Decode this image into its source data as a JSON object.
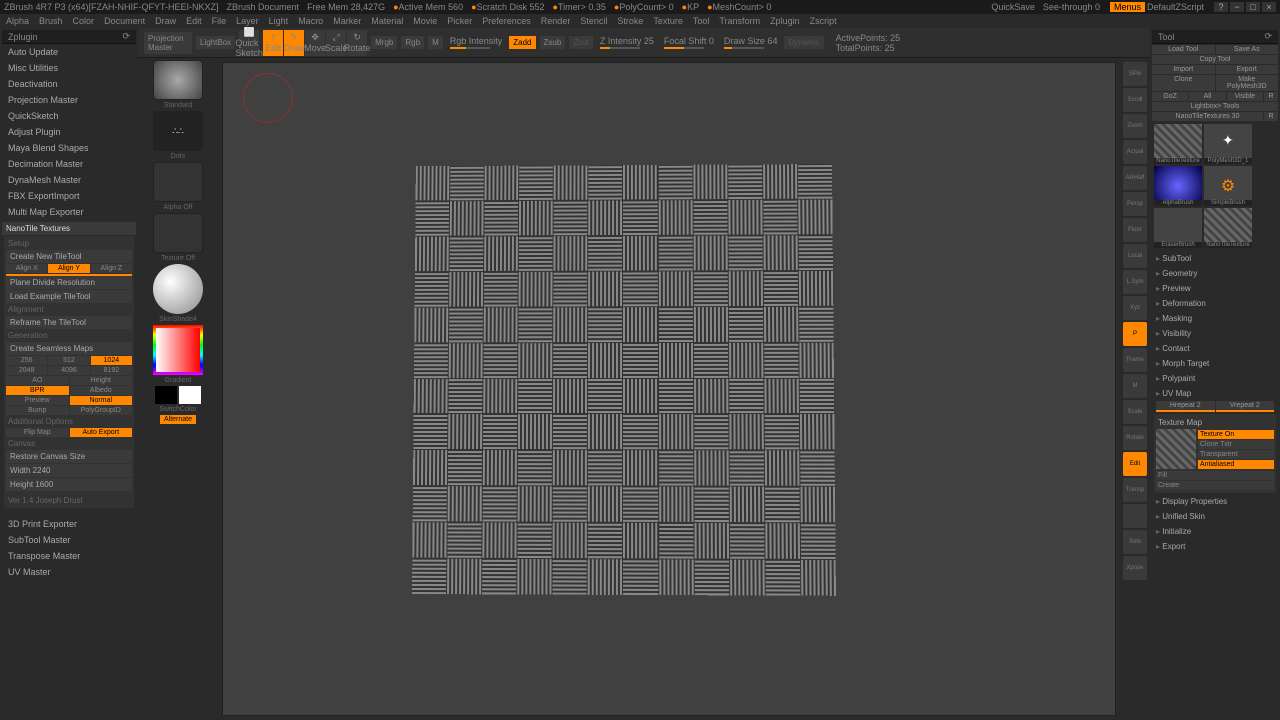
{
  "title": {
    "app": "ZBrush 4R7 P3 (x64)[FZAH-NHIF-QFYT-HEEI-NKXZ]",
    "doc": "ZBrush Document",
    "mem": "Free Mem 28,427G",
    "active": "Active Mem 560",
    "scratch": "Scratch Disk 552",
    "timer": "Timer> 0.35",
    "poly": "PolyCount> 0",
    "kp": "KP",
    "mesh": "MeshCount> 0",
    "quicksave": "QuickSave",
    "seethrough": "See-through  0",
    "menus": "Menus",
    "script": "DefaultZScript"
  },
  "menubar": [
    "Alpha",
    "Brush",
    "Color",
    "Document",
    "Draw",
    "Edit",
    "File",
    "Layer",
    "Light",
    "Macro",
    "Marker",
    "Material",
    "Movie",
    "Picker",
    "Preferences",
    "Render",
    "Stencil",
    "Stroke",
    "Texture",
    "Tool",
    "Transform",
    "Zplugin",
    "Zscript"
  ],
  "leftPanel": {
    "title": "Zplugin",
    "items": [
      "Auto Update",
      "Misc Utilities",
      "Deactivation",
      "Projection Master",
      "QuickSketch",
      "Adjust Plugin",
      "Maya Blend Shapes",
      "Decimation Master",
      "DynaMesh Master",
      "FBX ExportImport",
      "Multi Map Exporter"
    ],
    "nano": "NanoTile Textures",
    "setup": "Setup",
    "createTile": "Create New TileTool",
    "align": {
      "x": "Align X",
      "y": "Align Y",
      "z": "Align Z"
    },
    "plane": "Plane Divide Resolution",
    "loadEx": "Load Example TileTool",
    "alignment": "Alignment",
    "reframe": "Reframe The TileTool",
    "generation": "Generation",
    "createMaps": "Create Seamless Maps",
    "sizes": {
      "256": "256",
      "512": "512",
      "1024": "1024",
      "2048": "2048",
      "4096": "4096",
      "8192": "8192"
    },
    "maps": {
      "ao": "AO",
      "height": "Height",
      "bpr": "BPR",
      "albedo": "Albedo",
      "preview": "Preview",
      "normal": "Normal",
      "bump": "Bump",
      "polygroup": "PolyGroupID"
    },
    "addl": "Additional Options",
    "flip": "Flip Map",
    "autoexp": "Auto Export",
    "canvas": "Canvas",
    "restore": "Restore Canvas Size",
    "width": "Width 2240",
    "height": "Height 1600",
    "ver": "Ver 1.4 Joseph Drust",
    "bottom": [
      "3D Print Exporter",
      "SubTool Master",
      "Transpose Master",
      "UV Master"
    ]
  },
  "centerCol": {
    "proj": "Projection Master",
    "lightbox": "LightBox",
    "quick": "Quick Sketch",
    "standard": "Standard",
    "dots": "Dots",
    "alpha": "Alpha Off",
    "texture": "Texture Off",
    "mat": "SkinShade4",
    "grad": "Gradient",
    "switch": "SwitchColor",
    "alt": "Alternate"
  },
  "toolbar": {
    "edit": "Edit",
    "draw": "Draw",
    "move": "Move",
    "scale": "Scale",
    "rotate": "Rotate",
    "mrgb": "Mrgb",
    "rgb": "Rgb",
    "m": "M",
    "rgbint": "Rgb Intensity",
    "zadd": "Zadd",
    "zsub": "Zsub",
    "zcut": "Zcut",
    "zint": "Z Intensity 25",
    "focal": "Focal Shift 0",
    "drawsize": "Draw Size 64",
    "dynamic": "Dynamic",
    "active": "ActivePoints: 25",
    "total": "TotalPoints: 25"
  },
  "rside": [
    "SPix",
    "Scroll",
    "Zoom",
    "Actual",
    "AAHalf",
    "Persp",
    "Floor",
    "Local",
    "L.Sym",
    "Xyz",
    "P",
    "Frame",
    "M",
    "Scale",
    "Rotate",
    "Edit",
    "Transp",
    "",
    "Solo",
    "Xpose"
  ],
  "right": {
    "title": "Tool",
    "top": {
      "load": "Load Tool",
      "save": "Save As",
      "copy": "Copy Tool",
      "import": "Import",
      "export": "Export",
      "clone": "Clone",
      "make": "Make PolyMesh3D",
      "goz": "GoZ",
      "all": "All",
      "visible": "Visible",
      "r": "R"
    },
    "lightbox": "Lightbox> Tools",
    "nano": "NanoTileTextures  30",
    "thumbs": {
      "nanotile": "NanoTileTexture",
      "poly": "PolyMesh3D_1",
      "alpha": "AlphaBrush",
      "simple": "SimpleBrush",
      "eraser": "EraserBrush",
      "nano2": "NanoTileTexture"
    },
    "sections": [
      "SubTool",
      "Geometry",
      "Preview",
      "Deformation",
      "Masking",
      "Visibility",
      "Contact",
      "Morph Target",
      "Polypaint",
      "UV Map"
    ],
    "uv": {
      "hrepeat": "Hrepeat 2",
      "vrepeat": "Vrepeat 2"
    },
    "texmap": {
      "title": "Texture Map",
      "on": "Texture On",
      "clone": "Clone Txtr",
      "transp": "Transparent",
      "anti": "Antialiased",
      "fill": "Fill",
      "create": "Create"
    },
    "sections2": [
      "Display Properties",
      "Unified Skin",
      "Initialize",
      "Export"
    ]
  }
}
